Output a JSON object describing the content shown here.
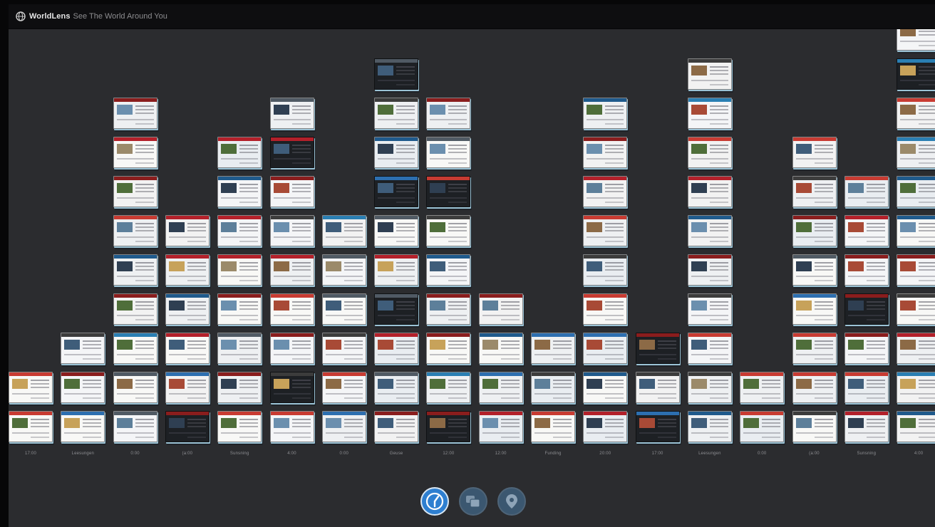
{
  "app": {
    "brand": "WorldLens",
    "tagline": "See The World Around You"
  },
  "colors": {
    "background": "#2b2c2f",
    "topbar": "#0e0e10",
    "accent": "#2e7fd0",
    "thumb_edge": "#9bc3d6"
  },
  "timeline": {
    "columns": [
      {
        "label": "17:00",
        "count": 2
      },
      {
        "label": "Leesungen",
        "count": 3
      },
      {
        "label": "0:00",
        "count": 9
      },
      {
        "label": "(a:00",
        "count": 6
      },
      {
        "label": "Sunsning",
        "count": 8
      },
      {
        "label": "4:00",
        "count": 9
      },
      {
        "label": "0:00",
        "count": 6
      },
      {
        "label": "Geuse",
        "count": 10
      },
      {
        "label": "12:00",
        "count": 9
      },
      {
        "label": "12:00",
        "count": 4
      },
      {
        "label": "Funding",
        "count": 3
      },
      {
        "label": "20:00",
        "count": 9
      },
      {
        "label": "17:00",
        "count": 3
      },
      {
        "label": "Leesungen",
        "count": 10
      },
      {
        "label": "0:00",
        "count": 2
      },
      {
        "label": "(a:00",
        "count": 8
      },
      {
        "label": "Sunsning",
        "count": 7
      },
      {
        "label": "4:00",
        "count": 11
      }
    ]
  },
  "controls": [
    {
      "name": "time-view-button",
      "icon": "clock-icon",
      "active": true
    },
    {
      "name": "category-view-button",
      "icon": "stack-icon",
      "active": false
    },
    {
      "name": "location-view-button",
      "icon": "map-pin-icon",
      "active": false
    }
  ]
}
